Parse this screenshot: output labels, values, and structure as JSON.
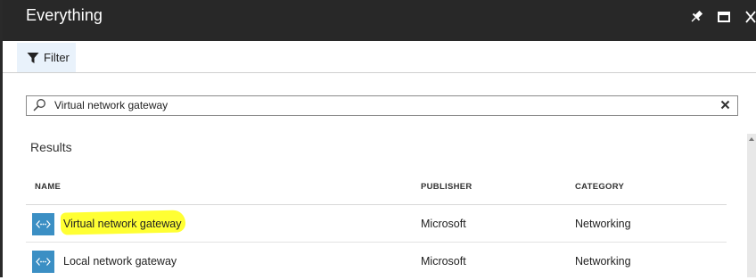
{
  "window": {
    "title": "Everything"
  },
  "toolbar": {
    "filter_label": "Filter"
  },
  "search": {
    "value": "Virtual network gateway"
  },
  "results": {
    "heading": "Results",
    "columns": {
      "name": "NAME",
      "publisher": "PUBLISHER",
      "category": "CATEGORY"
    },
    "rows": [
      {
        "name": "Virtual network gateway",
        "publisher": "Microsoft",
        "category": "Networking",
        "highlighted": true
      },
      {
        "name": "Local network gateway",
        "publisher": "Microsoft",
        "category": "Networking",
        "highlighted": false
      }
    ]
  },
  "colors": {
    "titlebar": "#282828",
    "filter_bg": "#e9f2fb",
    "icon_tile": "#3b8fc4",
    "highlight": "#ffff33"
  },
  "icons": [
    "pin-icon",
    "maximize-icon",
    "close-icon",
    "filter-icon",
    "search-icon",
    "clear-icon",
    "network-gateway-icon"
  ]
}
